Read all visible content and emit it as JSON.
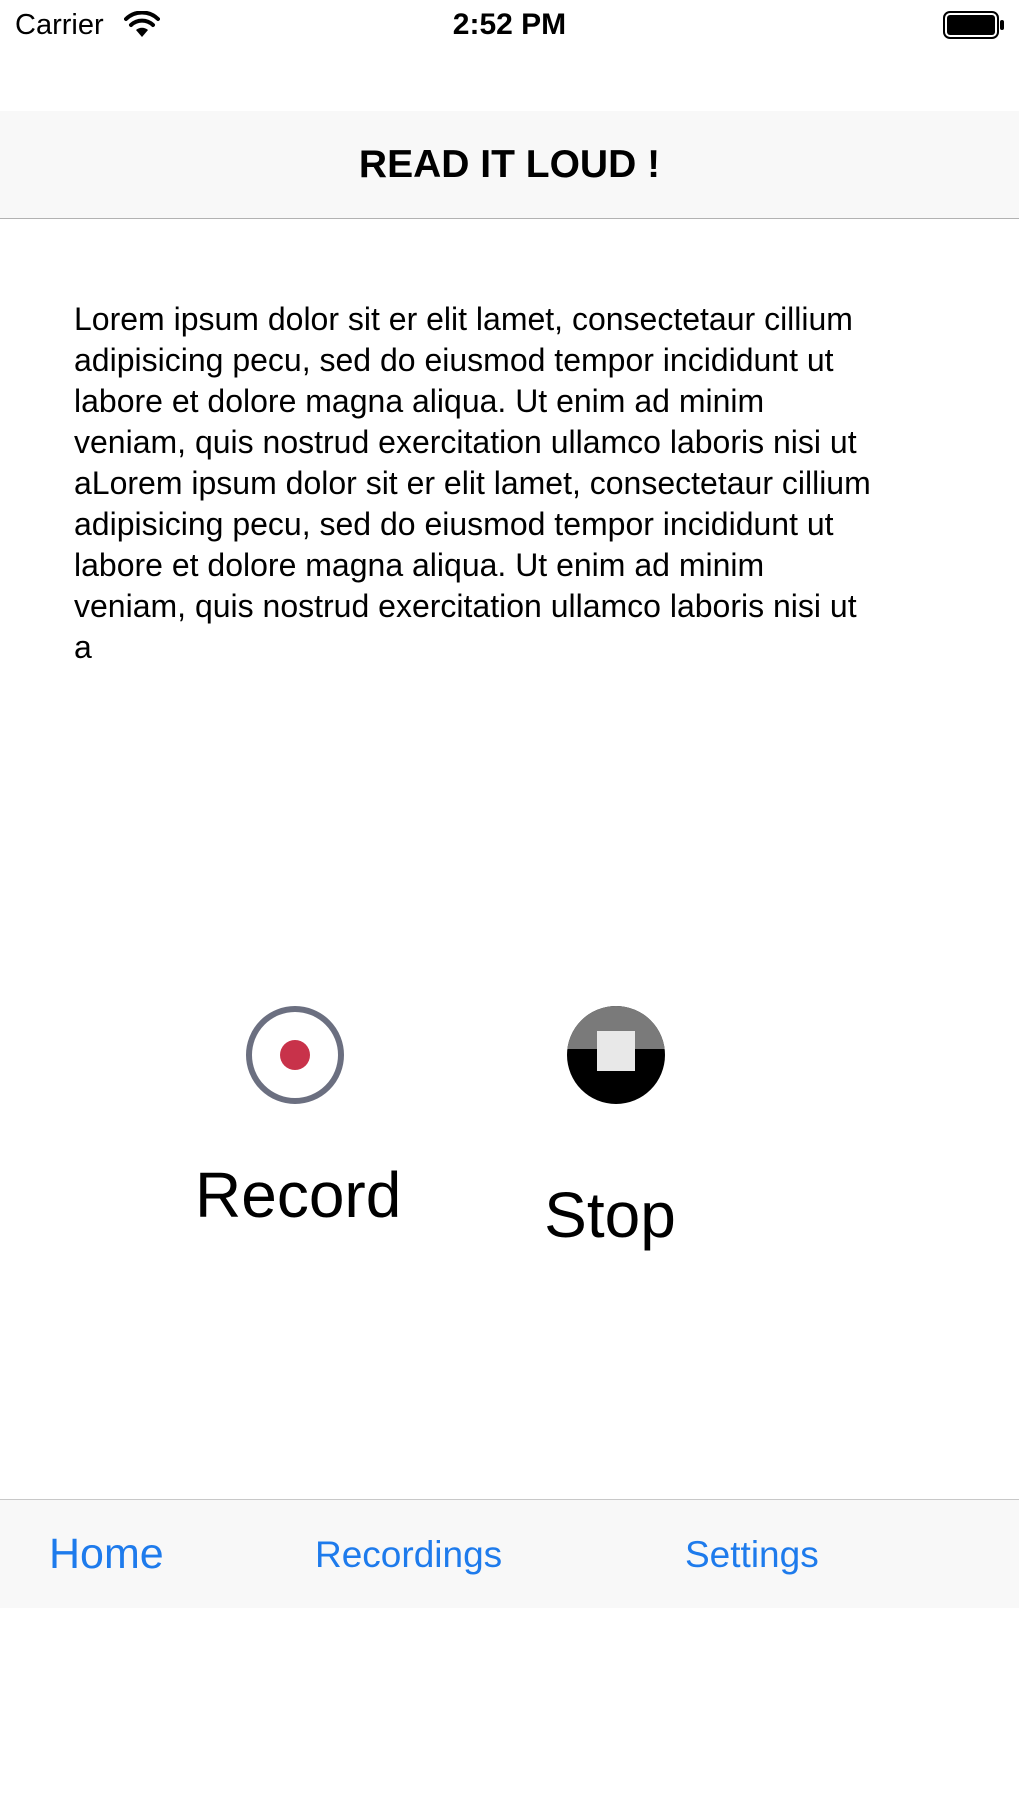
{
  "status_bar": {
    "carrier": "Carrier",
    "time": "2:52 PM",
    "wifi_icon": "wifi-icon",
    "battery_icon": "battery-icon"
  },
  "nav": {
    "title": "READ IT LOUD !"
  },
  "content": {
    "text": "Lorem ipsum dolor sit er elit lamet, consectetaur cillium adipisicing pecu, sed do eiusmod tempor incididunt ut labore et dolore magna aliqua. Ut enim ad minim veniam, quis nostrud exercitation ullamco laboris nisi ut aLorem ipsum dolor sit er elit lamet, consectetaur cillium adipisicing pecu, sed do eiusmod tempor incididunt ut labore et dolore magna aliqua. Ut enim ad minim veniam, quis nostrud exercitation ullamco laboris nisi ut a"
  },
  "controls": {
    "record_label": "Record",
    "stop_label": "Stop",
    "record_icon": "record-icon",
    "stop_icon": "stop-icon"
  },
  "tabs": [
    {
      "label": "Home"
    },
    {
      "label": "Recordings"
    },
    {
      "label": "Settings"
    }
  ],
  "colors": {
    "accent": "#1e7bec",
    "record_red": "#c8324a",
    "bar_background": "#f8f8f8"
  }
}
